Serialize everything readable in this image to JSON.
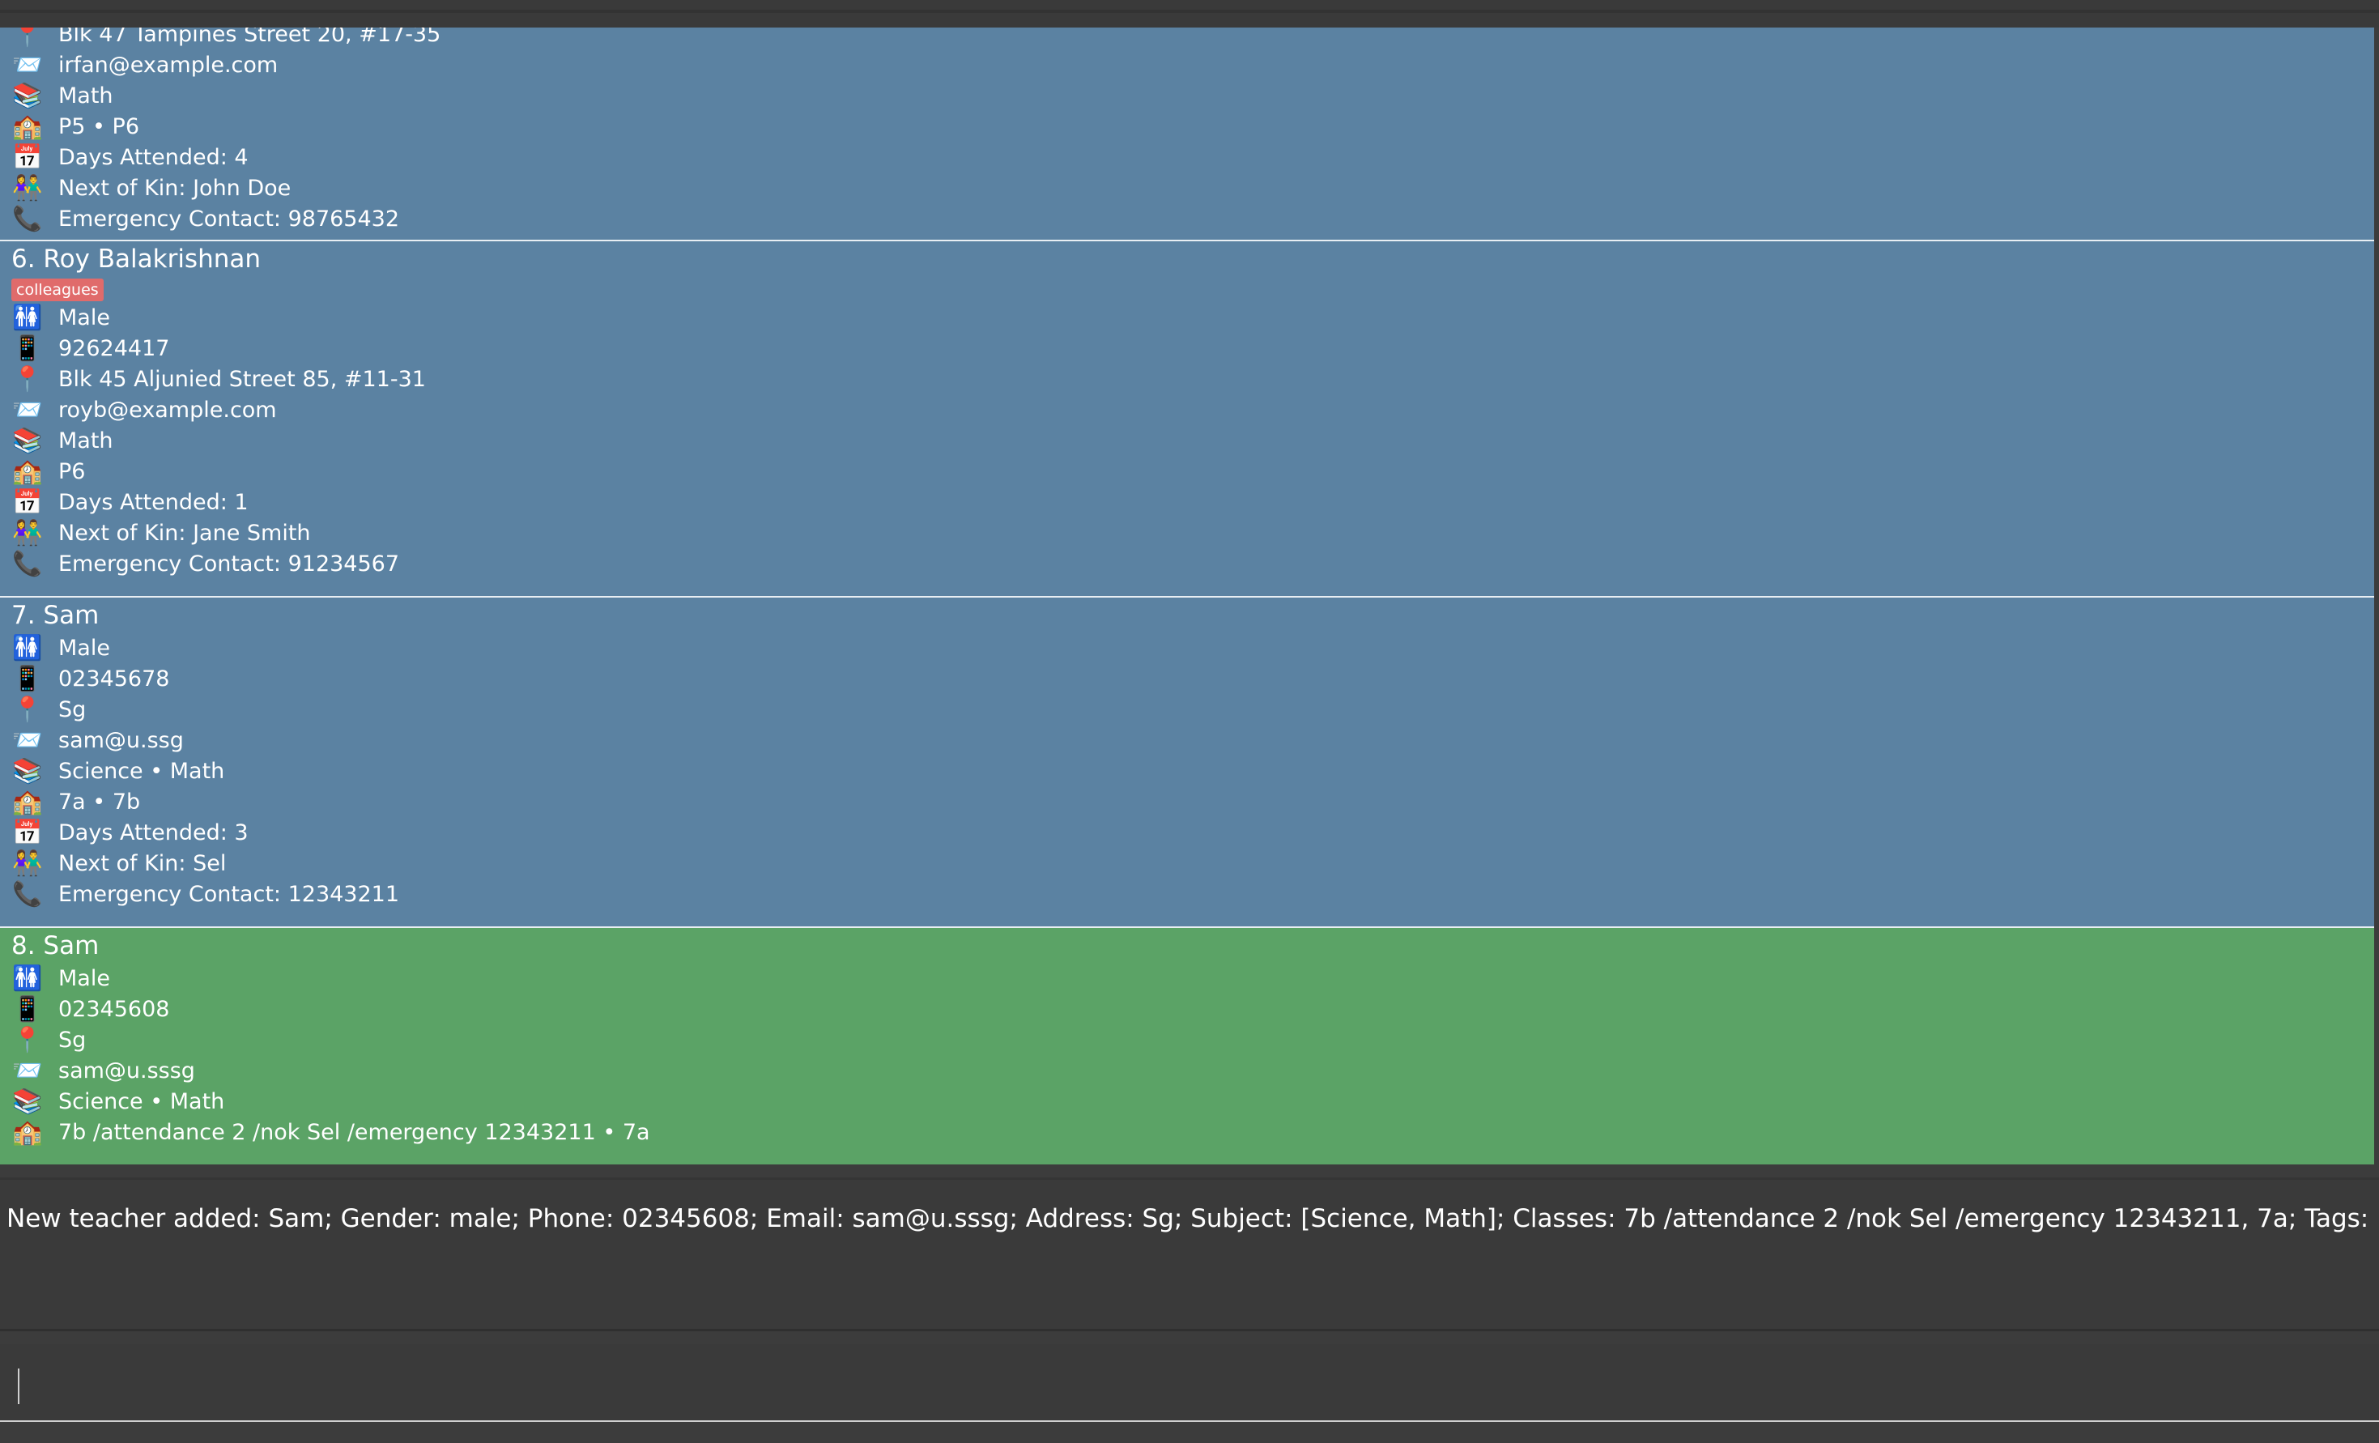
{
  "icons": {
    "address": "📍",
    "email": "📨",
    "subject": "📚",
    "classes": "🏫",
    "attendance": "📅",
    "nok": "👫",
    "emergency": "📞",
    "gender": "🚻",
    "phone": "📱"
  },
  "cards": [
    {
      "address": "Blk 47 Tampines Street 20, #17-35",
      "email": "irfan@example.com",
      "subjects": "Math",
      "classes": "P5 • P6",
      "attendance": "Days Attended: 4",
      "nok": "Next of Kin: John Doe",
      "emergency": "Emergency Contact: 98765432"
    },
    {
      "name": "6. Roy Balakrishnan",
      "tag": "colleagues",
      "gender": "Male",
      "phone": "92624417",
      "address": "Blk 45 Aljunied Street 85, #11-31",
      "email": "royb@example.com",
      "subjects": "Math",
      "classes": "P6",
      "attendance": "Days Attended: 1",
      "nok": "Next of Kin: Jane Smith",
      "emergency": "Emergency Contact: 91234567"
    },
    {
      "name": "7. Sam",
      "gender": "Male",
      "phone": "02345678",
      "address": "Sg",
      "email": "sam@u.ssg",
      "subjects": "Science • Math",
      "classes": "7a • 7b",
      "attendance": "Days Attended: 3",
      "nok": "Next of Kin: Sel",
      "emergency": "Emergency Contact: 12343211"
    },
    {
      "name": "8. Sam",
      "gender": "Male",
      "phone": "02345608",
      "address": "Sg",
      "email": "sam@u.sssg",
      "subjects": "Science • Math",
      "classes": "7b /attendance 2 /nok Sel /emergency 12343211 • 7a"
    }
  ],
  "result_text": "New teacher added: Sam; Gender: male; Phone: 02345608; Email: sam@u.sssg; Address: Sg; Subject: [Science, Math]; Classes: 7b /attendance 2 /nok Sel /emergency 12343211, 7a; Tags:",
  "command": {
    "value": "",
    "placeholder": ""
  },
  "colors": {
    "card": "#5b82a2",
    "selected_card": "#5ba366",
    "tag": "#e06b6b",
    "background": "#3c3c3c"
  }
}
